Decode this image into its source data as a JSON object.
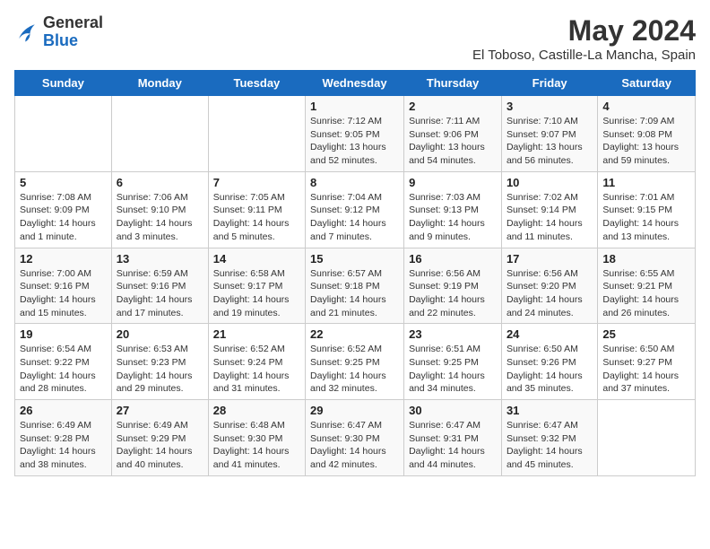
{
  "header": {
    "logo_line1": "General",
    "logo_line2": "Blue",
    "month_year": "May 2024",
    "location": "El Toboso, Castille-La Mancha, Spain"
  },
  "weekdays": [
    "Sunday",
    "Monday",
    "Tuesday",
    "Wednesday",
    "Thursday",
    "Friday",
    "Saturday"
  ],
  "weeks": [
    [
      {
        "day": null,
        "info": null
      },
      {
        "day": null,
        "info": null
      },
      {
        "day": null,
        "info": null
      },
      {
        "day": "1",
        "info": "Sunrise: 7:12 AM\nSunset: 9:05 PM\nDaylight: 13 hours and 52 minutes."
      },
      {
        "day": "2",
        "info": "Sunrise: 7:11 AM\nSunset: 9:06 PM\nDaylight: 13 hours and 54 minutes."
      },
      {
        "day": "3",
        "info": "Sunrise: 7:10 AM\nSunset: 9:07 PM\nDaylight: 13 hours and 56 minutes."
      },
      {
        "day": "4",
        "info": "Sunrise: 7:09 AM\nSunset: 9:08 PM\nDaylight: 13 hours and 59 minutes."
      }
    ],
    [
      {
        "day": "5",
        "info": "Sunrise: 7:08 AM\nSunset: 9:09 PM\nDaylight: 14 hours and 1 minute."
      },
      {
        "day": "6",
        "info": "Sunrise: 7:06 AM\nSunset: 9:10 PM\nDaylight: 14 hours and 3 minutes."
      },
      {
        "day": "7",
        "info": "Sunrise: 7:05 AM\nSunset: 9:11 PM\nDaylight: 14 hours and 5 minutes."
      },
      {
        "day": "8",
        "info": "Sunrise: 7:04 AM\nSunset: 9:12 PM\nDaylight: 14 hours and 7 minutes."
      },
      {
        "day": "9",
        "info": "Sunrise: 7:03 AM\nSunset: 9:13 PM\nDaylight: 14 hours and 9 minutes."
      },
      {
        "day": "10",
        "info": "Sunrise: 7:02 AM\nSunset: 9:14 PM\nDaylight: 14 hours and 11 minutes."
      },
      {
        "day": "11",
        "info": "Sunrise: 7:01 AM\nSunset: 9:15 PM\nDaylight: 14 hours and 13 minutes."
      }
    ],
    [
      {
        "day": "12",
        "info": "Sunrise: 7:00 AM\nSunset: 9:16 PM\nDaylight: 14 hours and 15 minutes."
      },
      {
        "day": "13",
        "info": "Sunrise: 6:59 AM\nSunset: 9:16 PM\nDaylight: 14 hours and 17 minutes."
      },
      {
        "day": "14",
        "info": "Sunrise: 6:58 AM\nSunset: 9:17 PM\nDaylight: 14 hours and 19 minutes."
      },
      {
        "day": "15",
        "info": "Sunrise: 6:57 AM\nSunset: 9:18 PM\nDaylight: 14 hours and 21 minutes."
      },
      {
        "day": "16",
        "info": "Sunrise: 6:56 AM\nSunset: 9:19 PM\nDaylight: 14 hours and 22 minutes."
      },
      {
        "day": "17",
        "info": "Sunrise: 6:56 AM\nSunset: 9:20 PM\nDaylight: 14 hours and 24 minutes."
      },
      {
        "day": "18",
        "info": "Sunrise: 6:55 AM\nSunset: 9:21 PM\nDaylight: 14 hours and 26 minutes."
      }
    ],
    [
      {
        "day": "19",
        "info": "Sunrise: 6:54 AM\nSunset: 9:22 PM\nDaylight: 14 hours and 28 minutes."
      },
      {
        "day": "20",
        "info": "Sunrise: 6:53 AM\nSunset: 9:23 PM\nDaylight: 14 hours and 29 minutes."
      },
      {
        "day": "21",
        "info": "Sunrise: 6:52 AM\nSunset: 9:24 PM\nDaylight: 14 hours and 31 minutes."
      },
      {
        "day": "22",
        "info": "Sunrise: 6:52 AM\nSunset: 9:25 PM\nDaylight: 14 hours and 32 minutes."
      },
      {
        "day": "23",
        "info": "Sunrise: 6:51 AM\nSunset: 9:25 PM\nDaylight: 14 hours and 34 minutes."
      },
      {
        "day": "24",
        "info": "Sunrise: 6:50 AM\nSunset: 9:26 PM\nDaylight: 14 hours and 35 minutes."
      },
      {
        "day": "25",
        "info": "Sunrise: 6:50 AM\nSunset: 9:27 PM\nDaylight: 14 hours and 37 minutes."
      }
    ],
    [
      {
        "day": "26",
        "info": "Sunrise: 6:49 AM\nSunset: 9:28 PM\nDaylight: 14 hours and 38 minutes."
      },
      {
        "day": "27",
        "info": "Sunrise: 6:49 AM\nSunset: 9:29 PM\nDaylight: 14 hours and 40 minutes."
      },
      {
        "day": "28",
        "info": "Sunrise: 6:48 AM\nSunset: 9:30 PM\nDaylight: 14 hours and 41 minutes."
      },
      {
        "day": "29",
        "info": "Sunrise: 6:47 AM\nSunset: 9:30 PM\nDaylight: 14 hours and 42 minutes."
      },
      {
        "day": "30",
        "info": "Sunrise: 6:47 AM\nSunset: 9:31 PM\nDaylight: 14 hours and 44 minutes."
      },
      {
        "day": "31",
        "info": "Sunrise: 6:47 AM\nSunset: 9:32 PM\nDaylight: 14 hours and 45 minutes."
      },
      {
        "day": null,
        "info": null
      }
    ]
  ]
}
